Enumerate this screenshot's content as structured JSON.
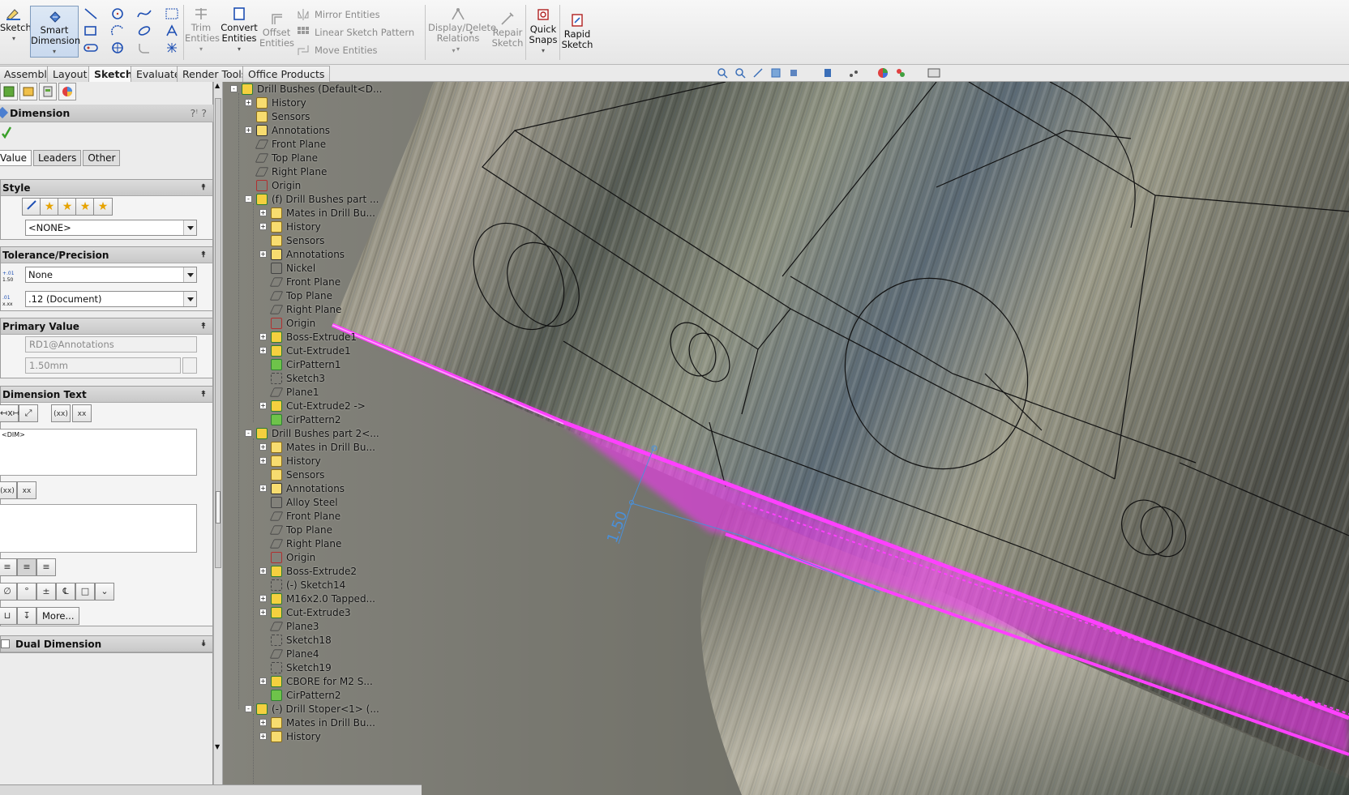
{
  "ribbon": {
    "sketch": "Sketch",
    "smart_dimension": [
      "Smart",
      "Dimension"
    ],
    "trim": [
      "Trim",
      "Entities"
    ],
    "convert": [
      "Convert",
      "Entities"
    ],
    "offset": [
      "Offset",
      "Entities"
    ],
    "mirror": "Mirror Entities",
    "linear_pattern": "Linear Sketch Pattern",
    "move": "Move Entities",
    "display_delete": [
      "Display/Delete",
      "Relations"
    ],
    "repair": [
      "Repair",
      "Sketch"
    ],
    "quick_snaps": [
      "Quick",
      "Snaps"
    ],
    "rapid_sketch": [
      "Rapid",
      "Sketch"
    ]
  },
  "tabs": [
    "Assembly",
    "Layout",
    "Sketch",
    "Evaluate",
    "Render Tools",
    "Office Products"
  ],
  "property_manager": {
    "title": "Dimension",
    "help": "?",
    "subtabs": [
      "Value",
      "Leaders",
      "Other"
    ],
    "style": {
      "header": "Style",
      "favorite": "<NONE>"
    },
    "tolerance": {
      "header": "Tolerance/Precision",
      "tolerance_type": "None",
      "precision": ".12 (Document)"
    },
    "primary": {
      "header": "Primary Value",
      "name": "RD1@Annotations",
      "value": "1.50mm"
    },
    "dimtext": {
      "header": "Dimension Text",
      "text": "<DIM>",
      "more": "More..."
    },
    "dual": {
      "header": "Dual Dimension"
    }
  },
  "tree": [
    {
      "label": "Drill Bushes  (Default<D...",
      "depth": 0,
      "exp": "-",
      "icon": "asm"
    },
    {
      "label": "History",
      "depth": 1,
      "exp": "+",
      "icon": "folder"
    },
    {
      "label": "Sensors",
      "depth": 1,
      "exp": "",
      "icon": "sensor"
    },
    {
      "label": "Annotations",
      "depth": 1,
      "exp": "+",
      "icon": "annot"
    },
    {
      "label": "Front Plane",
      "depth": 1,
      "exp": "",
      "icon": "plane"
    },
    {
      "label": "Top Plane",
      "depth": 1,
      "exp": "",
      "icon": "plane"
    },
    {
      "label": "Right Plane",
      "depth": 1,
      "exp": "",
      "icon": "plane"
    },
    {
      "label": "Origin",
      "depth": 1,
      "exp": "",
      "icon": "origin"
    },
    {
      "label": "(f) Drill Bushes part ...",
      "depth": 1,
      "exp": "-",
      "icon": "part"
    },
    {
      "label": "Mates in Drill Bu...",
      "depth": 2,
      "exp": "+",
      "icon": "folder"
    },
    {
      "label": "History",
      "depth": 2,
      "exp": "+",
      "icon": "folder"
    },
    {
      "label": "Sensors",
      "depth": 2,
      "exp": "",
      "icon": "sensor"
    },
    {
      "label": "Annotations",
      "depth": 2,
      "exp": "+",
      "icon": "annot"
    },
    {
      "label": "Nickel",
      "depth": 2,
      "exp": "",
      "icon": "material"
    },
    {
      "label": "Front Plane",
      "depth": 2,
      "exp": "",
      "icon": "plane"
    },
    {
      "label": "Top Plane",
      "depth": 2,
      "exp": "",
      "icon": "plane"
    },
    {
      "label": "Right Plane",
      "depth": 2,
      "exp": "",
      "icon": "plane"
    },
    {
      "label": "Origin",
      "depth": 2,
      "exp": "",
      "icon": "origin"
    },
    {
      "label": "Boss-Extrude1",
      "depth": 2,
      "exp": "+",
      "icon": "feature"
    },
    {
      "label": "Cut-Extrude1",
      "depth": 2,
      "exp": "+",
      "icon": "feature"
    },
    {
      "label": "CirPattern1",
      "depth": 2,
      "exp": "",
      "icon": "pattern"
    },
    {
      "label": "Sketch3",
      "depth": 2,
      "exp": "",
      "icon": "sketch"
    },
    {
      "label": "Plane1",
      "depth": 2,
      "exp": "",
      "icon": "plane"
    },
    {
      "label": "Cut-Extrude2 ->",
      "depth": 2,
      "exp": "+",
      "icon": "feature"
    },
    {
      "label": "CirPattern2",
      "depth": 2,
      "exp": "",
      "icon": "pattern"
    },
    {
      "label": "Drill Bushes part 2<...",
      "depth": 1,
      "exp": "-",
      "icon": "part"
    },
    {
      "label": "Mates in Drill Bu...",
      "depth": 2,
      "exp": "+",
      "icon": "folder"
    },
    {
      "label": "History",
      "depth": 2,
      "exp": "+",
      "icon": "folder"
    },
    {
      "label": "Sensors",
      "depth": 2,
      "exp": "",
      "icon": "sensor"
    },
    {
      "label": "Annotations",
      "depth": 2,
      "exp": "+",
      "icon": "annot"
    },
    {
      "label": "Alloy Steel",
      "depth": 2,
      "exp": "",
      "icon": "material"
    },
    {
      "label": "Front Plane",
      "depth": 2,
      "exp": "",
      "icon": "plane"
    },
    {
      "label": "Top Plane",
      "depth": 2,
      "exp": "",
      "icon": "plane"
    },
    {
      "label": "Right Plane",
      "depth": 2,
      "exp": "",
      "icon": "plane"
    },
    {
      "label": "Origin",
      "depth": 2,
      "exp": "",
      "icon": "origin"
    },
    {
      "label": "Boss-Extrude2",
      "depth": 2,
      "exp": "+",
      "icon": "feature"
    },
    {
      "label": "(-) Sketch14",
      "depth": 2,
      "exp": "",
      "icon": "sketch"
    },
    {
      "label": "M16x2.0 Tapped...",
      "depth": 2,
      "exp": "+",
      "icon": "feature"
    },
    {
      "label": "Cut-Extrude3",
      "depth": 2,
      "exp": "+",
      "icon": "feature"
    },
    {
      "label": "Plane3",
      "depth": 2,
      "exp": "",
      "icon": "plane"
    },
    {
      "label": "Sketch18",
      "depth": 2,
      "exp": "",
      "icon": "sketch"
    },
    {
      "label": "Plane4",
      "depth": 2,
      "exp": "",
      "icon": "plane"
    },
    {
      "label": "Sketch19",
      "depth": 2,
      "exp": "",
      "icon": "sketch"
    },
    {
      "label": "CBORE for M2 S...",
      "depth": 2,
      "exp": "+",
      "icon": "feature"
    },
    {
      "label": "CirPattern2",
      "depth": 2,
      "exp": "",
      "icon": "pattern"
    },
    {
      "label": "(-) Drill Stoper<1> (...",
      "depth": 1,
      "exp": "-",
      "icon": "part"
    },
    {
      "label": "Mates in Drill Bu...",
      "depth": 2,
      "exp": "+",
      "icon": "folder"
    },
    {
      "label": "History",
      "depth": 2,
      "exp": "+",
      "icon": "folder"
    }
  ],
  "viewport": {
    "dimension_label": "1.50",
    "highlight_color": "#ff33ff",
    "dimension_color": "#4a90d9"
  },
  "colors": {
    "ribbon_bg": "#ececec",
    "panel_bg": "#ececec",
    "accent": "#ff33ff"
  }
}
